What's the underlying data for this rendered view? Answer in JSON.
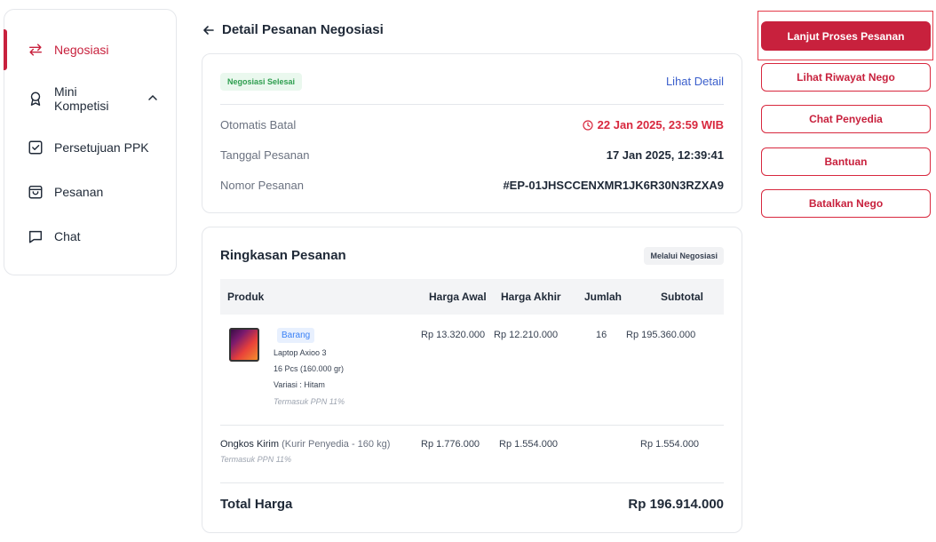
{
  "sidebar": {
    "items": [
      {
        "label": "Negosiasi",
        "icon": "swap-arrows-icon",
        "active": true
      },
      {
        "label": "Mini Kompetisi",
        "icon": "award-icon",
        "expanded": true
      },
      {
        "label": "Persetujuan PPK",
        "icon": "check-square-icon"
      },
      {
        "label": "Pesanan",
        "icon": "shopping-bag-icon"
      },
      {
        "label": "Chat",
        "icon": "message-icon"
      }
    ]
  },
  "header": {
    "back_arrow": "←",
    "title": "Detail Pesanan Negosiasi"
  },
  "order": {
    "status_badge": "Negosiasi Selesai",
    "detail_link": "Lihat Detail",
    "rows": [
      {
        "label": "Otomatis Batal",
        "value": "22 Jan 2025, 23:59 WIB"
      },
      {
        "label": "Tanggal Pesanan",
        "value": "17 Jan 2025, 12:39:41"
      },
      {
        "label": "Nomor Pesanan",
        "value": "#EP-01JHSCCENXMR1JK6R30N3RZXA9"
      }
    ]
  },
  "summary": {
    "title": "Ringkasan Pesanan",
    "via_badge": "Melalui Negosiasi",
    "columns": [
      "Produk",
      "Harga Awal",
      "Harga Akhir",
      "Jumlah",
      "Subtotal"
    ],
    "product": {
      "tag": "Barang",
      "name": "Laptop Axioo 3",
      "qty_weight": "16 Pcs (160.000 gr)",
      "variant": "Variasi   : Hitam",
      "tax_note": "Termasuk PPN 11%",
      "harga_awal": "Rp 13.320.000",
      "harga_akhir": "Rp 12.210.000",
      "jumlah": "16",
      "subtotal": "Rp 195.360.000"
    },
    "shipping": {
      "label": "Ongkos Kirim",
      "detail": "(Kurir Penyedia - 160 kg)",
      "tax_note": "Termasuk PPN 11%",
      "harga_awal": "Rp 1.776.000",
      "harga_akhir": "Rp 1.554.000",
      "subtotal": "Rp 1.554.000"
    },
    "total_label": "Total Harga",
    "total_value": "Rp 196.914.000"
  },
  "actions": {
    "primary": "Lanjut Proses Pesanan",
    "history": "Lihat Riwayat Nego",
    "chat": "Chat Penyedia",
    "help": "Bantuan",
    "cancel": "Batalkan Nego"
  },
  "colors": {
    "brand": "#c8213d",
    "link": "#3b5fcc",
    "success": "#2e9e4f"
  }
}
